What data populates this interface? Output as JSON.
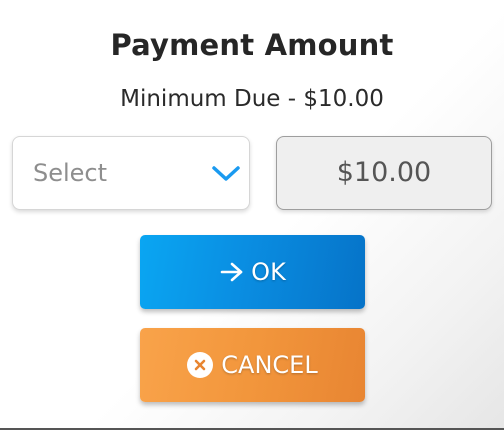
{
  "dialog": {
    "title": "Payment Amount",
    "subtitle": "Minimum Due - $10.00"
  },
  "select": {
    "placeholder": "Select",
    "icon": "chevron-down-icon"
  },
  "amount_field": {
    "value": "$10.00"
  },
  "buttons": {
    "ok_label": "OK",
    "ok_icon": "arrow-right-icon",
    "cancel_label": "CANCEL",
    "cancel_icon": "close-circle-icon"
  },
  "colors": {
    "ok_button": "#0a8ee2",
    "cancel_button": "#f2963c",
    "chevron": "#1a9af0",
    "title_text": "#262626"
  }
}
